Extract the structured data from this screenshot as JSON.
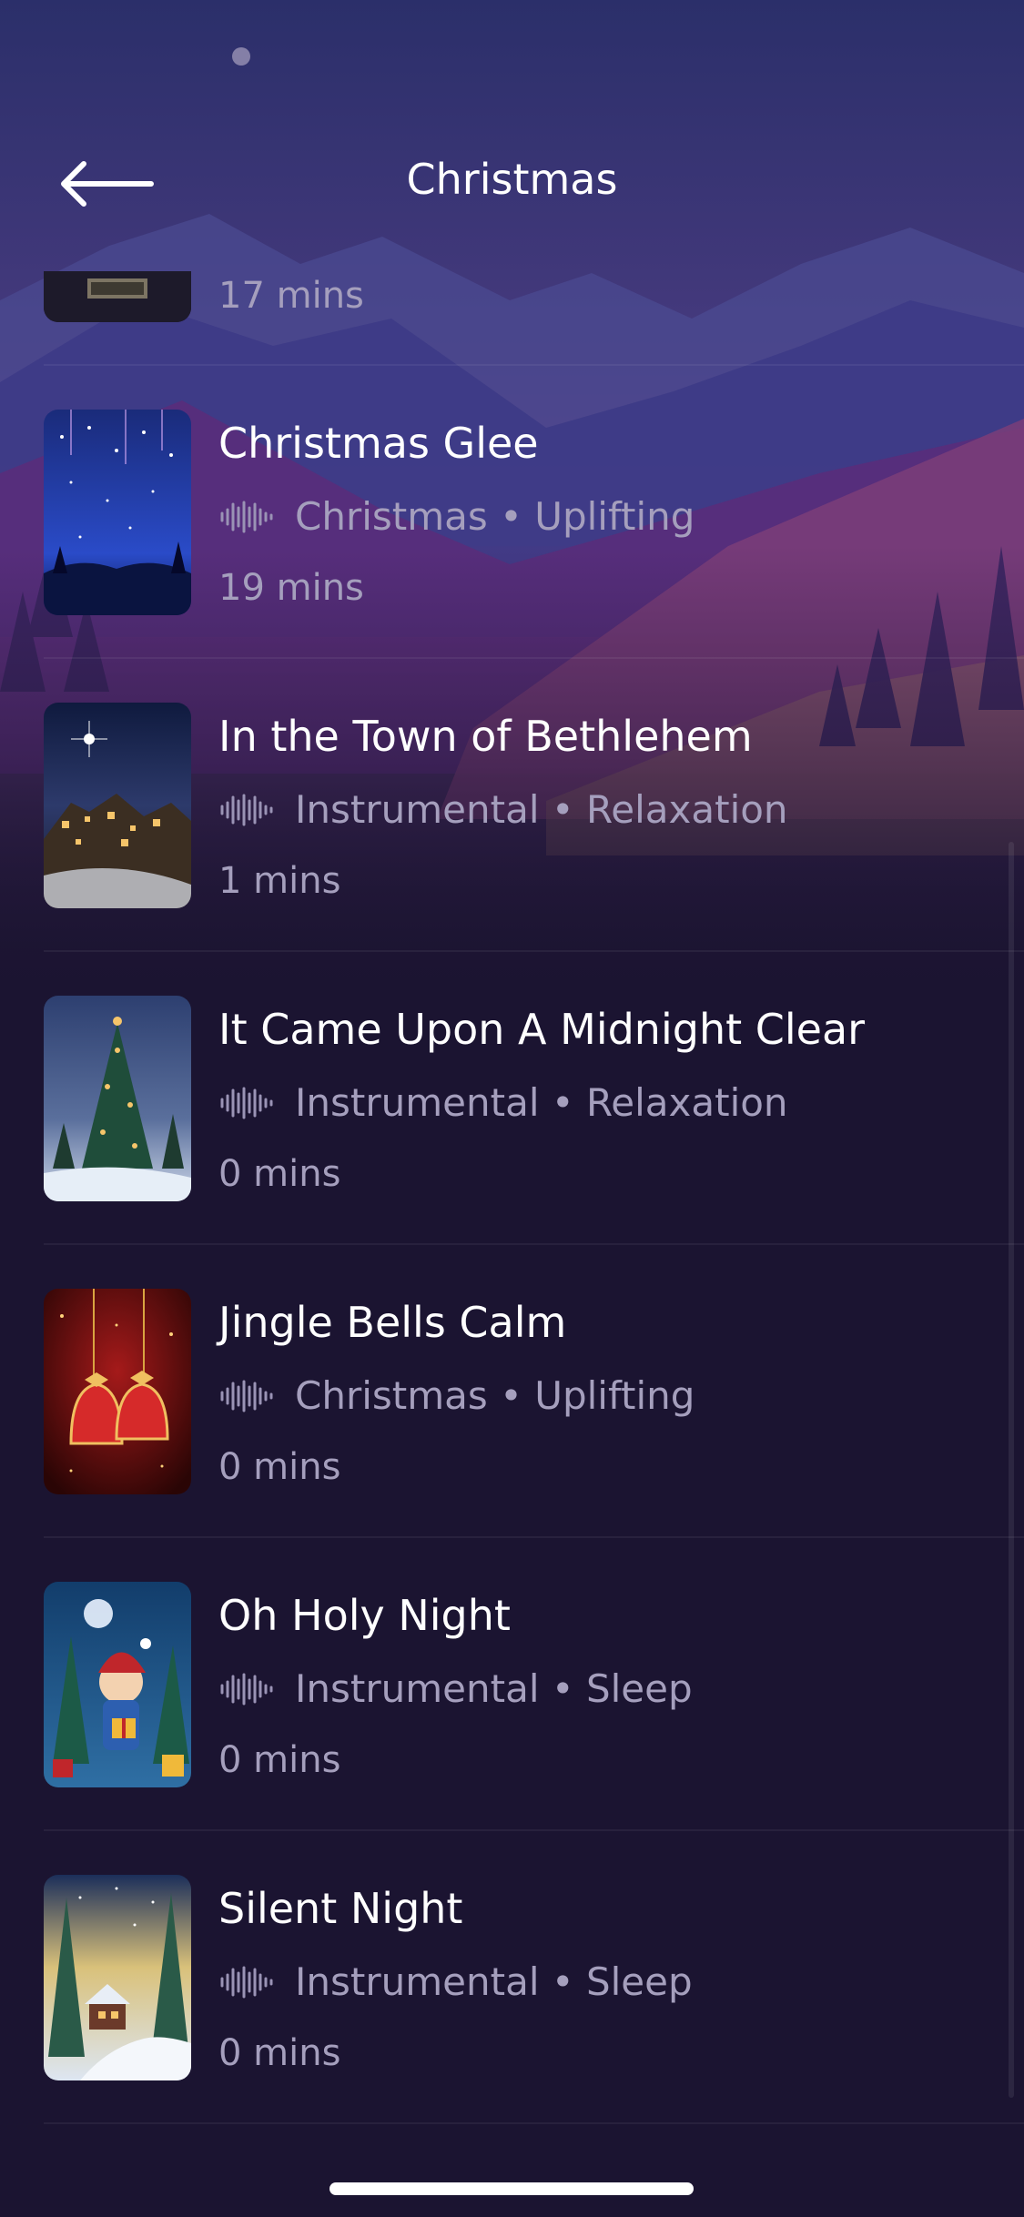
{
  "header": {
    "title": "Christmas"
  },
  "partial_item": {
    "duration": "17 mins"
  },
  "tracks": [
    {
      "title": "Christmas Glee",
      "tags": "Christmas • Uplifting",
      "duration": "19 mins"
    },
    {
      "title": "In the Town of Bethlehem",
      "tags": "Instrumental • Relaxation",
      "duration": "1 mins"
    },
    {
      "title": "It Came Upon A Midnight Clear",
      "tags": "Instrumental • Relaxation",
      "duration": "0 mins"
    },
    {
      "title": "Jingle Bells Calm",
      "tags": "Christmas • Uplifting",
      "duration": "0 mins"
    },
    {
      "title": "Oh Holy Night",
      "tags": "Instrumental • Sleep",
      "duration": "0 mins"
    },
    {
      "title": "Silent Night",
      "tags": "Instrumental • Sleep",
      "duration": "0 mins"
    }
  ],
  "icons": {
    "back": "arrow-left-icon",
    "waveform": "waveform-icon"
  },
  "colors": {
    "background": "#1b1431",
    "text_secondary": "#a59fbd",
    "accent_purple": "#6b3c8c"
  }
}
